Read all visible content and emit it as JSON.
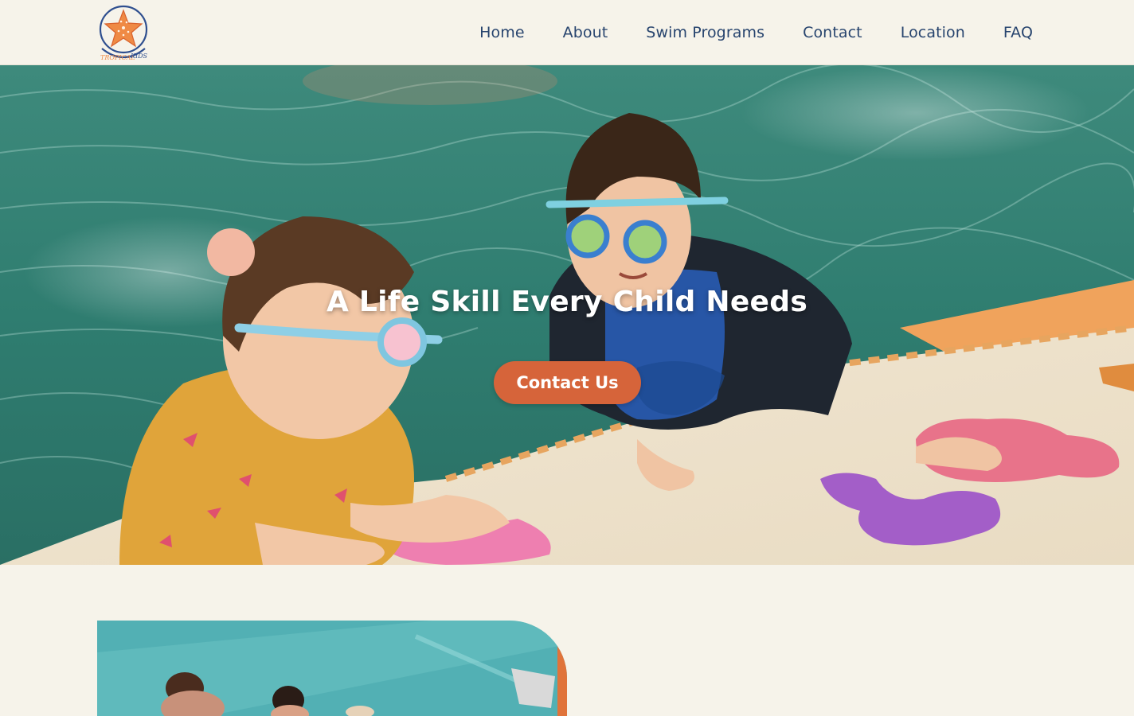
{
  "header": {
    "logo": {
      "text": "TROPICAL KIDS",
      "icon": "starfish-logo-icon"
    },
    "nav": [
      "Home",
      "About",
      "Swim Programs",
      "Contact",
      "Location",
      "FAQ"
    ]
  },
  "hero": {
    "title": "A Life Skill Every Child Needs",
    "cta_label": "Contact Us"
  },
  "colors": {
    "background": "#f6f3ea",
    "nav_text": "#27446e",
    "accent": "#d6643a",
    "water": "#3f8f82"
  }
}
